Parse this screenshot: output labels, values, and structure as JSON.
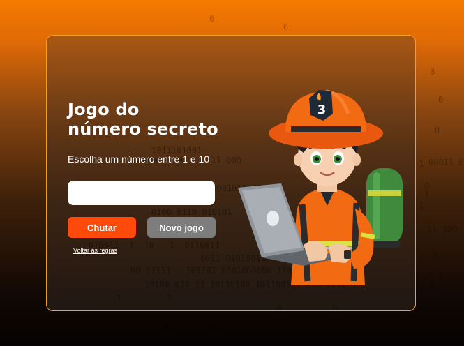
{
  "page": {
    "title_line1": "Jogo do",
    "title_line2": "número secreto",
    "instruction": "Escolha um número entre 1 e 10",
    "input_value": "",
    "guess_button_label": "Chutar",
    "new_game_button_label": "Novo jogo",
    "rules_link_label": "Voltar às regras"
  },
  "illustration": {
    "badge_number": "3",
    "description_icon": "firefighter-with-laptop-illustration"
  },
  "colors": {
    "accent_orange": "#ff4a0c",
    "border_gold": "#f0a020",
    "secondary_gray": "#7d7d7d"
  }
}
